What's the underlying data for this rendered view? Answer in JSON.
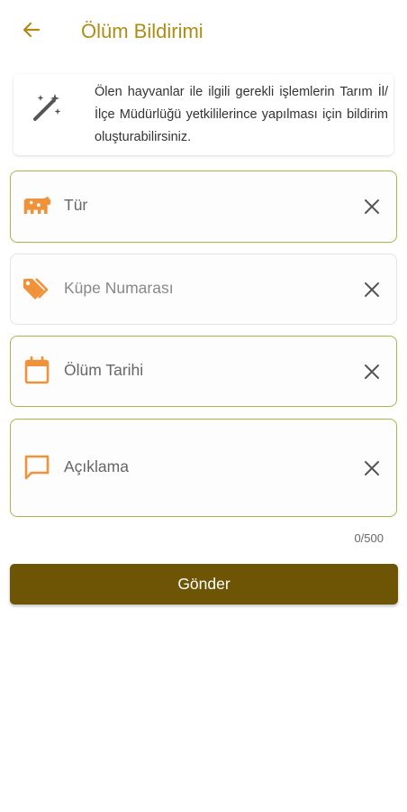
{
  "header": {
    "title": "Ölüm Bildirimi",
    "back_icon": "arrow-left-icon",
    "accent_color": "#b08c16"
  },
  "info": {
    "icon": "magic-wand-icon",
    "text": "Ölen hayvanlar ile ilgili gerekli işlemlerin Tarım İl/İlçe Müdürlüğü yetkililerince yapılması için bildirim oluşturabilirsiniz."
  },
  "form": {
    "fields": [
      {
        "label": "Tür",
        "icon": "cow-icon",
        "state": "active"
      },
      {
        "label": "Küpe Numarası",
        "icon": "tag-icon",
        "state": "inactive"
      },
      {
        "label": "Ölüm Tarihi",
        "icon": "calendar-icon",
        "state": "active"
      },
      {
        "label": "Açıklama",
        "icon": "comment-icon",
        "state": "active"
      }
    ],
    "icon_color": "#f0923a",
    "active_border_color": "#a6b84e",
    "counter": "0/500"
  },
  "submit": {
    "label": "Gönder",
    "color": "#6e5505"
  }
}
